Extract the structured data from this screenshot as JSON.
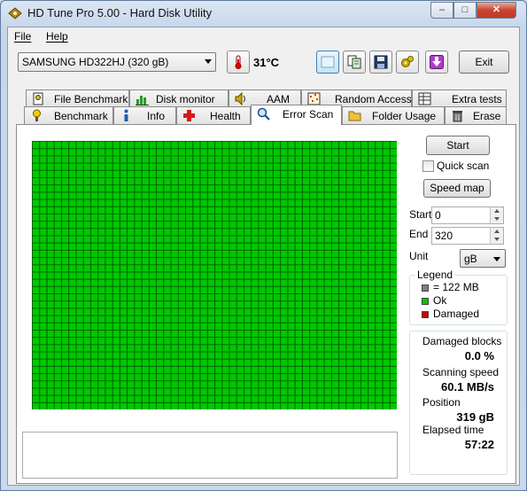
{
  "window": {
    "title": "HD Tune Pro 5.00 - Hard Disk Utility",
    "controls": {
      "minimize": "–",
      "maximize": "□",
      "close": "✕"
    }
  },
  "menu": {
    "file": "File",
    "help": "Help"
  },
  "toolbar": {
    "drive": "SAMSUNG HD322HJ (320 gB)",
    "temperature": "31°C",
    "exit_label": "Exit",
    "icons": [
      "thermometer-icon",
      "screenshot-icon",
      "copy-icon",
      "save-icon",
      "options-icon",
      "download-icon"
    ]
  },
  "tabs": {
    "top_row": [
      "File Benchmark",
      "Disk monitor",
      "AAM",
      "Random Access",
      "Extra tests"
    ],
    "bottom_row": [
      "Benchmark",
      "Info",
      "Health",
      "Error Scan",
      "Folder Usage",
      "Erase"
    ],
    "active": "Error Scan"
  },
  "scan": {
    "grid_cols": 50,
    "grid_rows": 37,
    "ok_fraction": 1.0,
    "log_text": ""
  },
  "controls": {
    "start_button": "Start",
    "quick_scan_label": "Quick scan",
    "quick_scan_checked": false,
    "speed_map_button": "Speed map",
    "start_label": "Start",
    "start_value": "0",
    "end_label": "End",
    "end_value": "320",
    "unit_label": "Unit",
    "unit_value": "gB"
  },
  "legend": {
    "title": "Legend",
    "items": [
      {
        "label": "= 122 MB",
        "color": "#7f7f7f"
      },
      {
        "label": "Ok",
        "color": "#00c800"
      },
      {
        "label": "Damaged",
        "color": "#d40000"
      }
    ]
  },
  "stats": {
    "damaged_blocks_label": "Damaged blocks",
    "damaged_blocks_value": "0.0 %",
    "scanning_speed_label": "Scanning speed",
    "scanning_speed_value": "60.1 MB/s",
    "position_label": "Position",
    "position_value": "319 gB",
    "elapsed_label": "Elapsed time",
    "elapsed_value": "57:22"
  },
  "colors": {
    "block_ok": "#00c800",
    "block_grid_line": "#006400",
    "accent": "#3c7fb1"
  }
}
